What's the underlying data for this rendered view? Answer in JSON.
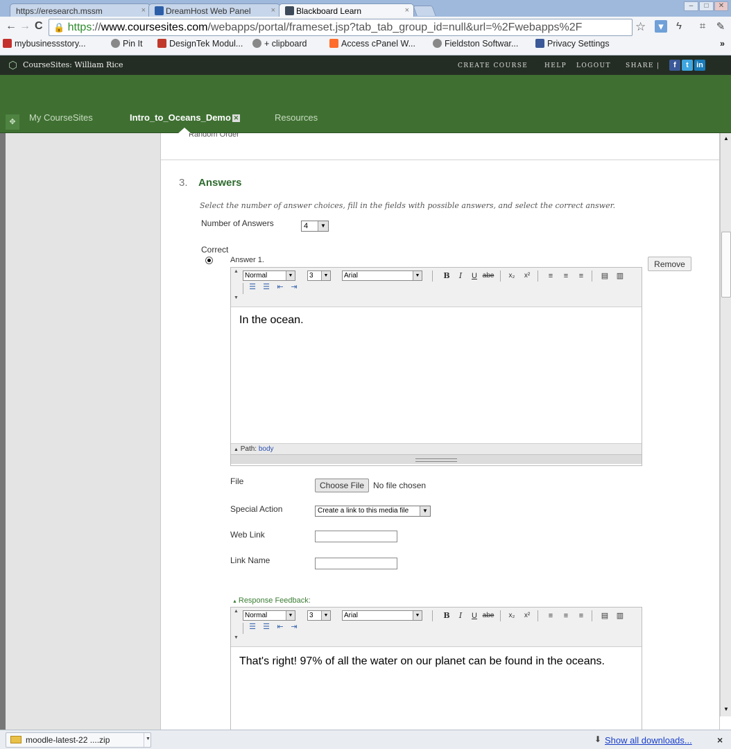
{
  "browser": {
    "tabs": [
      {
        "label": "https://eresearch.mssm",
        "active": false
      },
      {
        "label": "DreamHost Web Panel",
        "active": false
      },
      {
        "label": "Blackboard Learn",
        "active": true
      }
    ],
    "tab_close": "×",
    "url": {
      "protocol": "https",
      "separator": "://",
      "host": "www.coursesites.com",
      "path": "/webapps/portal/frameset.jsp?tab_tab_group_id=null&url=%2Fwebapps%2F"
    },
    "bookmarks": [
      {
        "label": "mybusinessstory...",
        "color": "#c4302b"
      },
      {
        "label": "Pin It",
        "color": "#888888"
      },
      {
        "label": "DesignTek Modul...",
        "color": "#c0392b"
      },
      {
        "label": "+ clipboard",
        "color": "#888888"
      },
      {
        "label": "Access cPanel W...",
        "color": "#ff6c2c"
      },
      {
        "label": "Fieldston Softwar...",
        "color": "#888888"
      },
      {
        "label": "Privacy Settings",
        "color": "#3b5998"
      }
    ],
    "bookmarks_overflow": "»"
  },
  "site": {
    "brand": "CourseSites: William Rice",
    "top_links": [
      "CREATE COURSE",
      "HELP",
      "LOGOUT",
      "SHARE |"
    ],
    "tabs": [
      {
        "label": "My CourseSites",
        "active": false
      },
      {
        "label": "Intro_to_Oceans_Demo",
        "active": true
      },
      {
        "label": "Resources",
        "active": false
      }
    ]
  },
  "form": {
    "cut_text": "Random Order",
    "step_number": "3.",
    "step_title": "Answers",
    "instructions": "Select the number of answer choices, fill in the fields with possible answers, and select the correct answer.",
    "number_of_answers_label": "Number of Answers",
    "number_of_answers_value": "4",
    "correct_label": "Correct",
    "answer_label": "Answer 1.",
    "remove_label": "Remove",
    "editor": {
      "format": "Normal",
      "size": "3",
      "font": "Arial",
      "path_label": "Path:",
      "path_value": "body"
    },
    "answer_text": "In the ocean.",
    "file_label": "File",
    "choose_file_label": "Choose File",
    "no_file_label": "No file chosen",
    "special_action_label": "Special Action",
    "special_action_value": "Create a link to this media file",
    "web_link_label": "Web Link",
    "link_name_label": "Link Name",
    "response_feedback_label": "Response Feedback:",
    "feedback_text": "That's right! 97% of all the water on our planet can be found in the oceans."
  },
  "downloads": {
    "file_label": "moodle-latest-22 ....zip",
    "show_all_label": "Show all downloads...",
    "close_label": "×"
  }
}
